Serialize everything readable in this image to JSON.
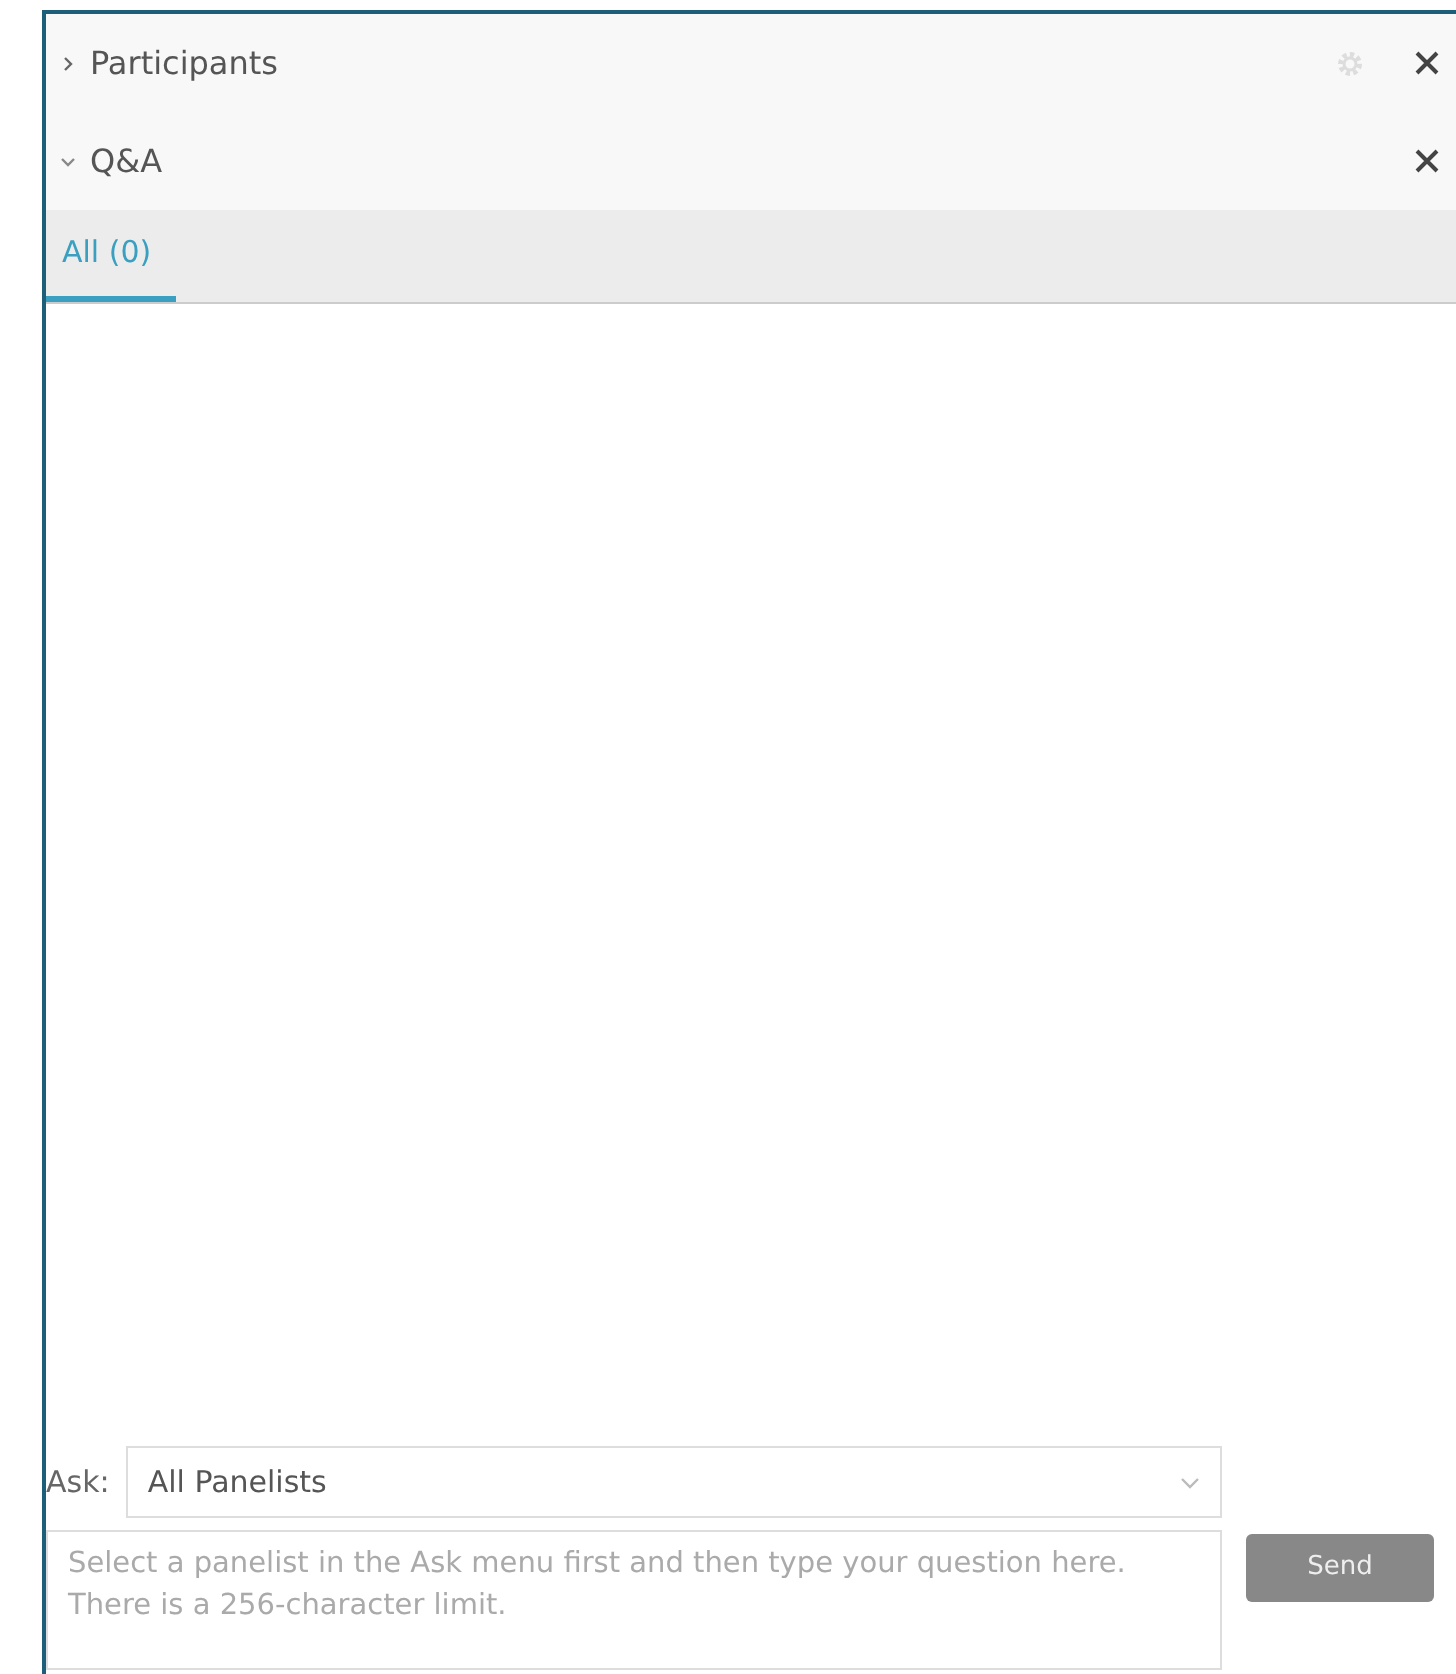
{
  "panels": [
    {
      "title": "Participants",
      "expanded": false,
      "settings": true
    },
    {
      "title": "Q&A",
      "expanded": true,
      "settings": false
    }
  ],
  "tabs": [
    {
      "label": "All (0)",
      "selected": true
    }
  ],
  "ask": {
    "label": "Ask:",
    "value": "All Panelists"
  },
  "question": {
    "placeholder": "Select a panelist in the Ask menu first and then type your question here. There is a 256-character limit."
  },
  "send": {
    "label": "Send",
    "disabled": true
  }
}
